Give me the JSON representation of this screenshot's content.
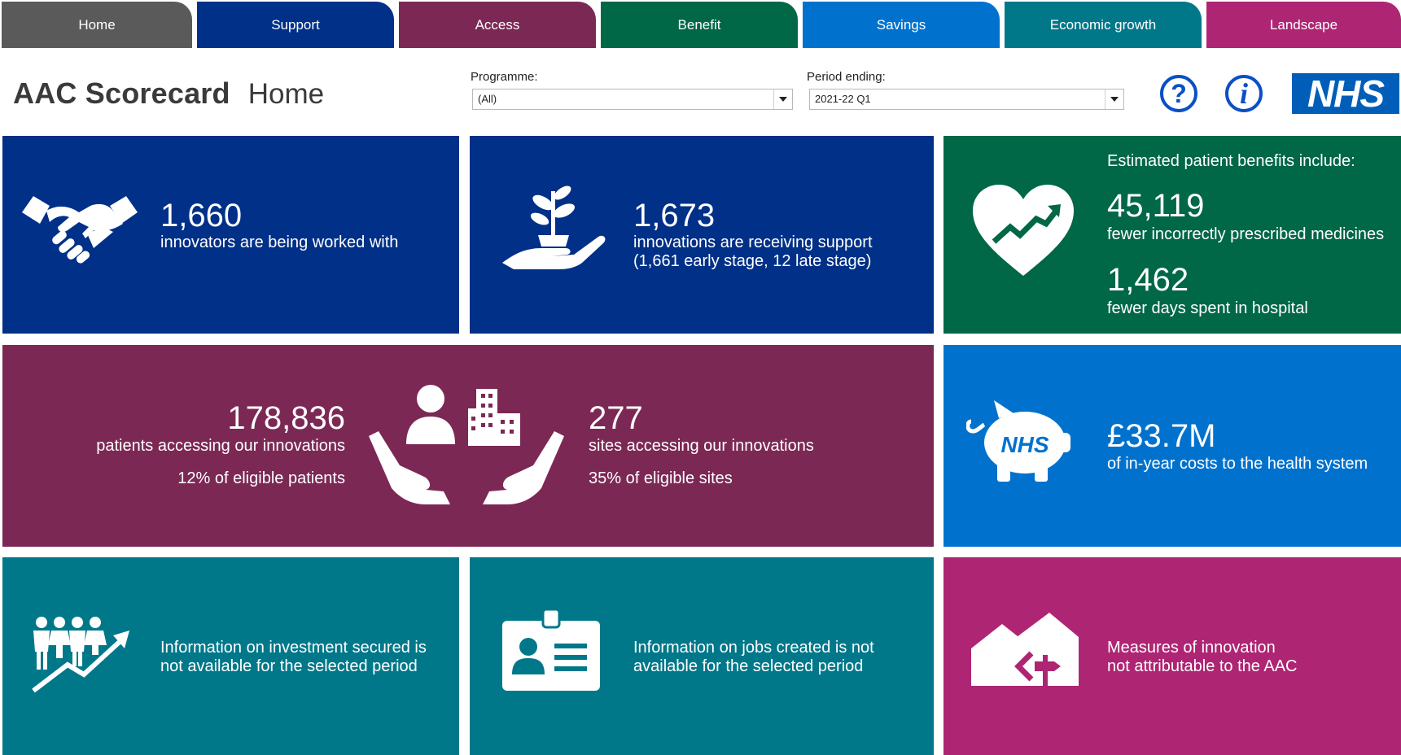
{
  "tabs": [
    {
      "label": "Home",
      "color": "#5a5a5a"
    },
    {
      "label": "Support",
      "color": "#003087"
    },
    {
      "label": "Access",
      "color": "#7c2855"
    },
    {
      "label": "Benefit",
      "color": "#006747"
    },
    {
      "label": "Savings",
      "color": "#0072CE"
    },
    {
      "label": "Economic growth",
      "color": "#00788A"
    },
    {
      "label": "Landscape",
      "color": "#AE2573"
    }
  ],
  "header": {
    "app_title": "AAC Scorecard",
    "page_title": "Home",
    "programme_label": "Programme:",
    "programme_value": "(All)",
    "period_label": "Period ending:",
    "period_value": "2021-22 Q1",
    "help_icon_glyph": "?",
    "info_icon_glyph": "i",
    "nhs_logo": "NHS"
  },
  "tiles": {
    "innovators": {
      "value": "1,660",
      "text": "innovators are being worked with",
      "color": "#003087",
      "icon": "handshake-icon"
    },
    "innovations": {
      "value": "1,673",
      "line1": "innovations are receiving support",
      "line2": "(1,661 early stage, 12 late stage)",
      "color": "#003087",
      "icon": "plant-in-hand-icon"
    },
    "benefits": {
      "heading": "Estimated patient benefits include:",
      "value1": "45,119",
      "text1": "fewer incorrectly prescribed medicines",
      "value2": "1,462",
      "text2": "fewer days spent in hospital",
      "color": "#006747",
      "icon": "heart-chart-icon"
    },
    "access": {
      "patients_value": "178,836",
      "patients_text": "patients accessing our innovations",
      "patients_pct": "12% of eligible patients",
      "sites_value": "277",
      "sites_text": "sites accessing our innovations",
      "sites_pct": "35% of eligible sites",
      "color": "#7c2855",
      "icon": "people-buildings-hands-icon"
    },
    "savings": {
      "value": "£33.7M",
      "text": "of in-year costs to the health system",
      "piggy_label": "NHS",
      "color": "#0072CE",
      "icon": "piggy-bank-icon"
    },
    "investment": {
      "line1": "Information on investment secured is",
      "line2": "not available for the selected period",
      "color": "#00788A",
      "icon": "people-growth-icon"
    },
    "jobs": {
      "line1": "Information on jobs created is not",
      "line2": "available for the selected period",
      "color": "#00788A",
      "icon": "id-badge-icon"
    },
    "landscape": {
      "line1": "Measures of innovation",
      "line2": "not attributable to the AAC",
      "color": "#AE2573",
      "icon": "houses-signpost-icon"
    }
  }
}
